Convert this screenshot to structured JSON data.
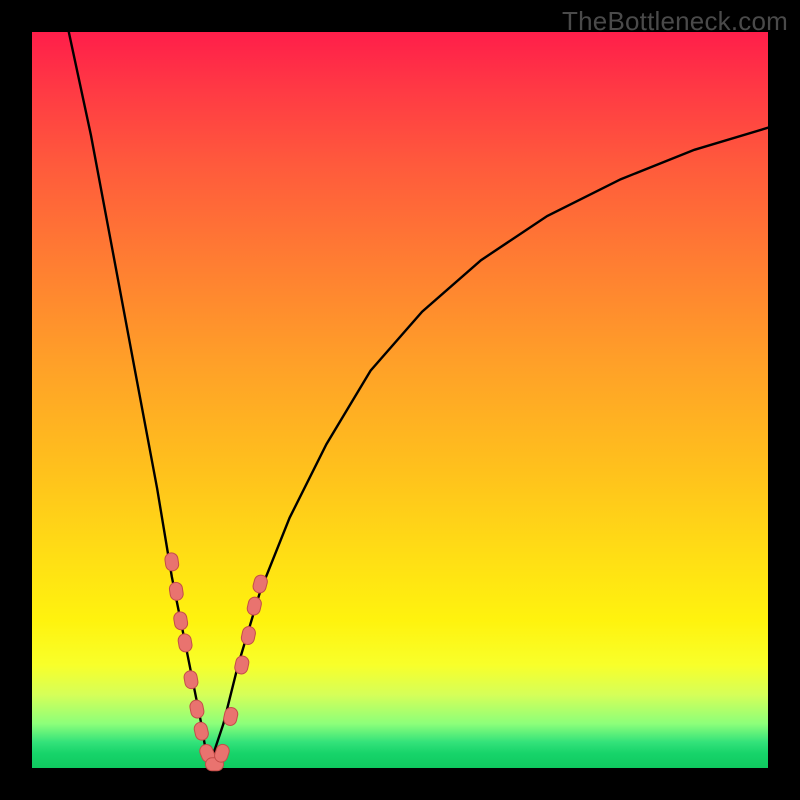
{
  "watermark": "TheBottleneck.com",
  "colors": {
    "frame_bg": "#000000",
    "gradient_top": "#ff1e4a",
    "gradient_mid1": "#ff7a33",
    "gradient_mid2": "#ffe014",
    "gradient_bottom": "#0fc95f",
    "curve_stroke": "#000000",
    "marker_fill": "#e9736f",
    "marker_stroke": "#c44d49"
  },
  "chart_data": {
    "type": "line",
    "title": "",
    "xlabel": "",
    "ylabel": "",
    "xlim": [
      0,
      100
    ],
    "ylim": [
      0,
      100
    ],
    "grid": false,
    "legend": false,
    "note": "V-shaped bottleneck curve. Values approximate percentage bottleneck (y) vs relative hardware balance position (x). Minimum near x≈24 where y≈0.",
    "series": [
      {
        "name": "bottleneck-curve-left",
        "x": [
          5,
          8,
          11,
          14,
          17,
          19,
          21,
          23,
          24
        ],
        "values": [
          100,
          86,
          70,
          54,
          38,
          26,
          16,
          6,
          0
        ]
      },
      {
        "name": "bottleneck-curve-right",
        "x": [
          24,
          26,
          28,
          31,
          35,
          40,
          46,
          53,
          61,
          70,
          80,
          90,
          100
        ],
        "values": [
          0,
          6,
          14,
          24,
          34,
          44,
          54,
          62,
          69,
          75,
          80,
          84,
          87
        ]
      }
    ],
    "markers": {
      "name": "sample-points",
      "note": "Pink capsule/round markers clustered near the valley on both branches.",
      "points": [
        {
          "x": 19.0,
          "y": 28
        },
        {
          "x": 19.6,
          "y": 24
        },
        {
          "x": 20.2,
          "y": 20
        },
        {
          "x": 20.8,
          "y": 17
        },
        {
          "x": 21.6,
          "y": 12
        },
        {
          "x": 22.4,
          "y": 8
        },
        {
          "x": 23.0,
          "y": 5
        },
        {
          "x": 23.8,
          "y": 2
        },
        {
          "x": 24.8,
          "y": 0.5
        },
        {
          "x": 25.8,
          "y": 2
        },
        {
          "x": 27.0,
          "y": 7
        },
        {
          "x": 28.5,
          "y": 14
        },
        {
          "x": 29.4,
          "y": 18
        },
        {
          "x": 30.2,
          "y": 22
        },
        {
          "x": 31.0,
          "y": 25
        }
      ]
    }
  }
}
